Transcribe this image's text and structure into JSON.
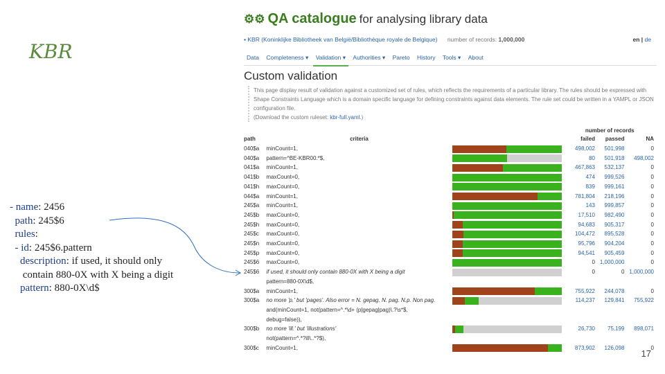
{
  "slide": {
    "title": "KBR",
    "page_number": "17",
    "yaml": {
      "name_key": "- name",
      "name_val": ": 2456",
      "path_key": "path",
      "path_val": ": 245$6",
      "rules_key": "rules",
      "rules_val": ":",
      "id_key": "- id",
      "id_val": ": 245$6.pattern",
      "desc_key": "description",
      "desc_val": ": if used, it should only",
      "desc_val2": "contain 880-0X with X being a digit",
      "pattern_key": "pattern",
      "pattern_val": ": 880-0X\\d$"
    }
  },
  "app": {
    "icon": "gears-icon",
    "name": "QA catalogue",
    "tagline": "for analysing library data",
    "library": "KBR (Koninklijke Bibliotheek van België/Bibliothèque royale de Belgique)",
    "records_label": "number of records:",
    "records_value": "1,000,000",
    "lang_en": "en",
    "lang_sep": "|",
    "lang_de": "de"
  },
  "nav": [
    "Data",
    "Completeness ▾",
    "Validation ▾",
    "Authorities ▾",
    "Pareto",
    "History",
    "Tools ▾",
    "About"
  ],
  "nav_active": "Validation ▾",
  "page": {
    "title": "Custom validation",
    "desc1": "This page display result of validation against a customized set of rules, which reflects the requirements of a particular library. The rules should be expressed with Shape Constraints Language which is a domain specific language for defining constraints against data elements. The rule set could be written in a YAMPL or JSON configuration file.",
    "desc2_prefix": "(Download the custom ruleset: ",
    "desc2_link": "kbr-full.yaml",
    "desc2_suffix": ".)"
  },
  "table": {
    "group_header": "number of records",
    "headers": {
      "path": "path",
      "criteria": "criteria",
      "failed": "failed",
      "passed": "passed",
      "na": "NA"
    },
    "rows": [
      {
        "path": "040$a",
        "criteria": "minCount=1,",
        "italic": false,
        "failed": "498,002",
        "passed": "501,998",
        "na": "0",
        "fr": 0.498,
        "pr": 0.502,
        "nr": 0
      },
      {
        "path": "040$a",
        "criteria": "pattern=^BE-KBR00.*$,",
        "italic": false,
        "failed": "80",
        "passed": "501,918",
        "na": "498,002",
        "fr": 0.0,
        "pr": 0.502,
        "nr": 0.498
      },
      {
        "path": "041$a",
        "criteria": "minCount=1,",
        "italic": false,
        "failed": "467,863",
        "passed": "532,137",
        "na": "0",
        "fr": 0.468,
        "pr": 0.532,
        "nr": 0
      },
      {
        "path": "041$b",
        "criteria": "maxCount=0,",
        "italic": false,
        "failed": "474",
        "passed": "999,526",
        "na": "0",
        "fr": 0.0,
        "pr": 1,
        "nr": 0
      },
      {
        "path": "041$h",
        "criteria": "maxCount=0,",
        "italic": false,
        "failed": "839",
        "passed": "999,161",
        "na": "0",
        "fr": 0.0,
        "pr": 1,
        "nr": 0
      },
      {
        "path": "044$a",
        "criteria": "minCount=1,",
        "italic": false,
        "failed": "781,804",
        "passed": "218,196",
        "na": "0",
        "fr": 0.782,
        "pr": 0.218,
        "nr": 0
      },
      {
        "path": "245$a",
        "criteria": "minCount=1,",
        "italic": false,
        "failed": "143",
        "passed": "999,857",
        "na": "0",
        "fr": 0.0,
        "pr": 1,
        "nr": 0
      },
      {
        "path": "245$b",
        "criteria": "maxCount=0,",
        "italic": false,
        "failed": "17,510",
        "passed": "982,490",
        "na": "0",
        "fr": 0.018,
        "pr": 0.982,
        "nr": 0
      },
      {
        "path": "245$h",
        "criteria": "maxCount=0,",
        "italic": false,
        "failed": "94,683",
        "passed": "905,317",
        "na": "0",
        "fr": 0.095,
        "pr": 0.905,
        "nr": 0
      },
      {
        "path": "245$c",
        "criteria": "maxCount=0,",
        "italic": false,
        "failed": "104,472",
        "passed": "895,528",
        "na": "0",
        "fr": 0.104,
        "pr": 0.896,
        "nr": 0
      },
      {
        "path": "245$n",
        "criteria": "maxCount=0,",
        "italic": false,
        "failed": "95,796",
        "passed": "904,204",
        "na": "0",
        "fr": 0.096,
        "pr": 0.904,
        "nr": 0
      },
      {
        "path": "245$p",
        "criteria": "maxCount=0,",
        "italic": false,
        "failed": "94,541",
        "passed": "905,459",
        "na": "0",
        "fr": 0.095,
        "pr": 0.905,
        "nr": 0
      },
      {
        "path": "245$6",
        "criteria": "maxCount=0,",
        "italic": false,
        "failed": "0",
        "passed": "1,000,000",
        "na": "0",
        "fr": 0,
        "pr": 1,
        "nr": 0
      },
      {
        "path": "245$6",
        "criteria": "if used, it should only contain 880-0X with X being a digit",
        "italic": true,
        "criteria2": "pattern=880-0X\\d$,",
        "failed": "0",
        "passed": "0",
        "na": "1,000,000",
        "fr": 0,
        "pr": 0,
        "nr": 1
      },
      {
        "path": "300$a",
        "criteria": "minCount=1,",
        "italic": false,
        "failed": "755,922",
        "passed": "244,078",
        "na": "0",
        "fr": 0.756,
        "pr": 0.244,
        "nr": 0
      },
      {
        "path": "300$a",
        "criteria": "no more 'p.' but 'pages'. Also error = N. gepag. N. pag. N.p. Non pag.",
        "italic": true,
        "criteria2": "and(minCount=1, not(pattern=^.*\\d+ (p|gepag|pag)\\.?\\s*$,",
        "criteria3": "debug=false)),",
        "failed": "114,237",
        "passed": "129,841",
        "na": "755,922",
        "fr": 0.114,
        "pr": 0.13,
        "nr": 0.756
      },
      {
        "path": "300$b",
        "criteria": "no more 'ill.' but 'illustrations'",
        "italic": true,
        "criteria2": "not(pattern=^.*?ill\\..*?$),",
        "failed": "26,730",
        "passed": "75,199",
        "na": "898,071",
        "fr": 0.027,
        "pr": 0.075,
        "nr": 0.898
      },
      {
        "path": "300$c",
        "criteria": "minCount=1,",
        "italic": false,
        "failed": "873,902",
        "passed": "126,098",
        "na": "0",
        "fr": 0.874,
        "pr": 0.126,
        "nr": 0
      }
    ]
  }
}
